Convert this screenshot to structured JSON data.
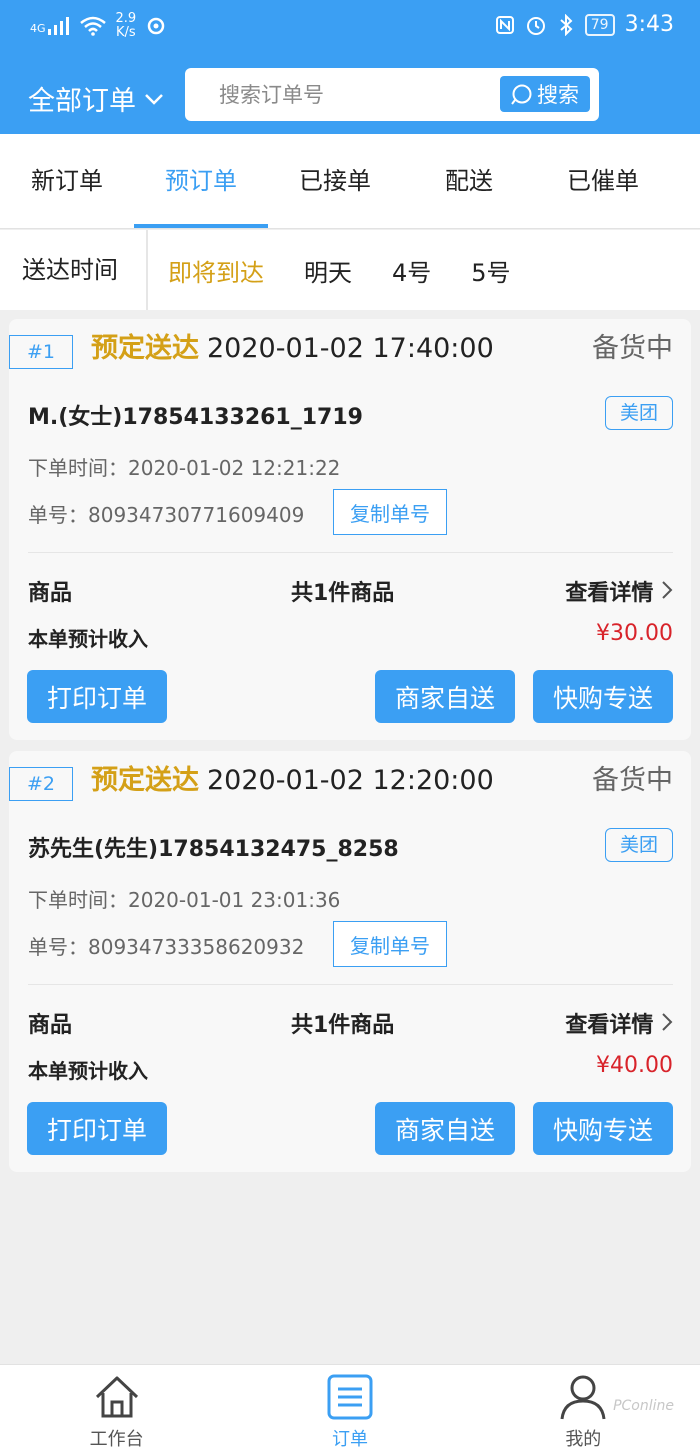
{
  "status_bar": {
    "signal": "4G",
    "speed_value": "2.9",
    "speed_unit": "K/s",
    "battery": "79",
    "time": "3:43"
  },
  "header": {
    "filter_label": "全部订单",
    "search_placeholder": "搜索订单号",
    "search_button": "搜索"
  },
  "tabs": [
    {
      "label": "新订单"
    },
    {
      "label": "预订单"
    },
    {
      "label": "已接单"
    },
    {
      "label": "配送"
    },
    {
      "label": "已催单"
    }
  ],
  "time_filter": {
    "label": "送达时间",
    "options": [
      {
        "label": "即将到达"
      },
      {
        "label": "明天"
      },
      {
        "label": "4号"
      },
      {
        "label": "5号"
      }
    ]
  },
  "orders": [
    {
      "index": "#1",
      "schedule_label": "预定送达",
      "schedule_time": "2020-01-02 17:40:00",
      "status": "备货中",
      "customer": "M.(女士)17854133261_1719",
      "platform": "美团",
      "ordered_at": "下单时间：2020-01-02 12:21:22",
      "order_no": "单号：80934730771609409",
      "copy_label": "复制单号",
      "goods_label": "商品",
      "goods_count": "共1件商品",
      "detail_label": "查看详情",
      "income_label": "本单预计收入",
      "income": "¥30.00",
      "btn_print": "打印订单",
      "btn_self": "商家自送",
      "btn_fast": "快购专送"
    },
    {
      "index": "#2",
      "schedule_label": "预定送达",
      "schedule_time": "2020-01-02 12:20:00",
      "status": "备货中",
      "customer": "苏先生(先生)17854132475_8258",
      "platform": "美团",
      "ordered_at": "下单时间：2020-01-01 23:01:36",
      "order_no": "单号：80934733358620932",
      "copy_label": "复制单号",
      "goods_label": "商品",
      "goods_count": "共1件商品",
      "detail_label": "查看详情",
      "income_label": "本单预计收入",
      "income": "¥40.00",
      "btn_print": "打印订单",
      "btn_self": "商家自送",
      "btn_fast": "快购专送"
    }
  ],
  "bottom_nav": [
    {
      "label": "工作台",
      "icon": "home-icon"
    },
    {
      "label": "订单",
      "icon": "order-list-icon"
    },
    {
      "label": "我的",
      "icon": "user-icon"
    }
  ],
  "watermark": "PConline",
  "colors": {
    "brand": "#3b9ff3",
    "schedule": "#d4a017",
    "income": "#d8232a"
  }
}
